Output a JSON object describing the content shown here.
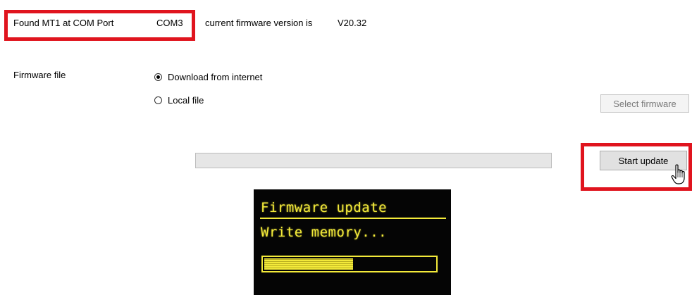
{
  "status": {
    "found_label": "Found MT1 at COM Port",
    "com_port": "COM3",
    "firmware_label": "current firmware version is",
    "firmware_version": "V20.32"
  },
  "firmware_file": {
    "label": "Firmware file",
    "options": [
      {
        "label": "Download from internet",
        "selected": true
      },
      {
        "label": "Local file",
        "selected": false
      }
    ],
    "select_button_label": "Select firmware"
  },
  "update": {
    "progress": 0,
    "start_button_label": "Start update"
  },
  "device_display": {
    "title": "Firmware update",
    "message": "Write memory...",
    "progress": 0.52
  },
  "colors": {
    "highlight": "#e0141e",
    "lcd_text": "#f3ea3a",
    "lcd_background": "#050505"
  },
  "icons": {
    "cursor": "hand-pointer-icon"
  }
}
